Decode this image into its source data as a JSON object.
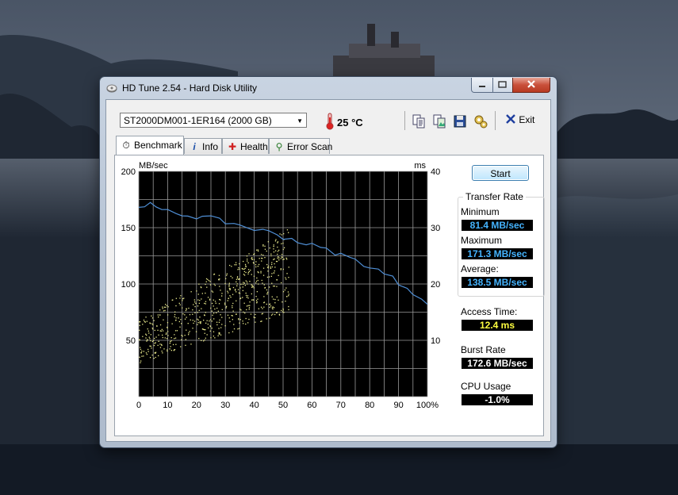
{
  "window": {
    "title": "HD Tune 2.54 - Hard Disk Utility"
  },
  "toolbar": {
    "drive": "ST2000DM001-1ER164 (2000 GB)",
    "temperature": "25 °C",
    "exit_label": "Exit"
  },
  "tabs": [
    {
      "label": "Benchmark",
      "icon": "stopwatch-icon"
    },
    {
      "label": "Info",
      "icon": "info-icon"
    },
    {
      "label": "Health",
      "icon": "health-cross-icon"
    },
    {
      "label": "Error Scan",
      "icon": "magnifier-icon"
    }
  ],
  "benchmark": {
    "start_label": "Start",
    "transfer_rate_title": "Transfer Rate",
    "minimum_label": "Minimum",
    "minimum_value": "81.4 MB/sec",
    "maximum_label": "Maximum",
    "maximum_value": "171.3 MB/sec",
    "average_label": "Average:",
    "average_value": "138.5 MB/sec",
    "access_time_label": "Access Time:",
    "access_time_value": "12.4 ms",
    "burst_rate_label": "Burst Rate",
    "burst_rate_value": "172.6 MB/sec",
    "cpu_usage_label": "CPU Usage",
    "cpu_usage_value": "-1.0%"
  },
  "colors": {
    "rate_value": "#45b4ff",
    "access_value": "#ffff40",
    "white_value": "#ffffff",
    "transfer_line": "#4f8fd6",
    "access_dots": "#e8e88c",
    "grid": "#9a9a9a"
  },
  "chart_data": {
    "type": "line",
    "left_axis_unit": "MB/sec",
    "right_axis_unit": "ms",
    "x_ticks": [
      "0",
      "10",
      "20",
      "30",
      "40",
      "50",
      "60",
      "70",
      "80",
      "90",
      "100%"
    ],
    "y_left_ticks": [
      "200",
      "150",
      "100",
      "50"
    ],
    "y_right_ticks": [
      "40",
      "30",
      "20",
      "10"
    ],
    "xlim": [
      0,
      100
    ],
    "ylim_left": [
      0,
      200
    ],
    "ylim_right": [
      0,
      40
    ],
    "series": [
      {
        "name": "Transfer Rate",
        "axis": "left",
        "x": [
          0,
          2,
          4,
          6,
          8,
          10,
          13,
          15,
          17,
          20,
          22,
          25,
          28,
          30,
          33,
          35,
          38,
          40,
          43,
          45,
          48,
          50,
          53,
          55,
          58,
          60,
          63,
          65,
          68,
          70,
          73,
          75,
          78,
          80,
          83,
          85,
          88,
          90,
          93,
          95,
          98,
          100
        ],
        "y": [
          168,
          171,
          170,
          167,
          165,
          164,
          163,
          162,
          161,
          160,
          159,
          158,
          156,
          155,
          154,
          152,
          150,
          149,
          147,
          146,
          144,
          142,
          140,
          138,
          136,
          134,
          132,
          130,
          128,
          126,
          123,
          121,
          118,
          115,
          112,
          109,
          105,
          101,
          97,
          93,
          88,
          82
        ]
      }
    ],
    "access_time_scatter": {
      "axis": "right",
      "x_range": [
        0,
        52
      ],
      "y_range_ms": [
        6,
        31
      ],
      "point_count": 650
    }
  }
}
